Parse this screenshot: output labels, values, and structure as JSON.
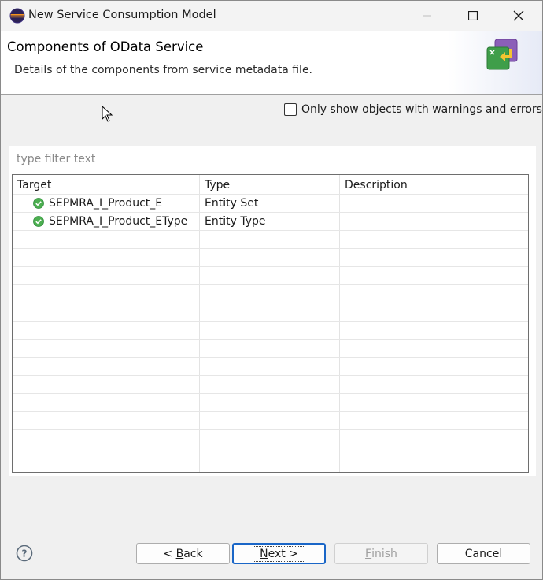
{
  "window": {
    "title": "New Service Consumption Model"
  },
  "header": {
    "title": "Components of OData Service",
    "description": "Details of the components from service metadata file."
  },
  "options": {
    "only_warnings_label": "Only show objects with warnings and errors",
    "only_warnings_checked": false
  },
  "filter": {
    "placeholder": "type filter text",
    "value": ""
  },
  "table": {
    "columns": [
      "Target",
      "Type",
      "Description"
    ],
    "rows": [
      {
        "target": "SEPMRA_I_Product_E",
        "type": "Entity Set",
        "description": "",
        "status_icon": "check-ok-icon"
      },
      {
        "target": "SEPMRA_I_Product_EType",
        "type": "Entity Type",
        "description": "",
        "status_icon": "check-ok-icon"
      }
    ]
  },
  "buttons": {
    "back": {
      "prefix": "< ",
      "mnemonic": "B",
      "rest": "ack"
    },
    "next": {
      "mnemonic": "N",
      "rest": "ext >"
    },
    "finish": {
      "mnemonic": "F",
      "rest": "inish",
      "enabled": false
    },
    "cancel": "Cancel"
  },
  "colors": {
    "accent": "#1a66c7",
    "ok_green": "#4caf50"
  }
}
